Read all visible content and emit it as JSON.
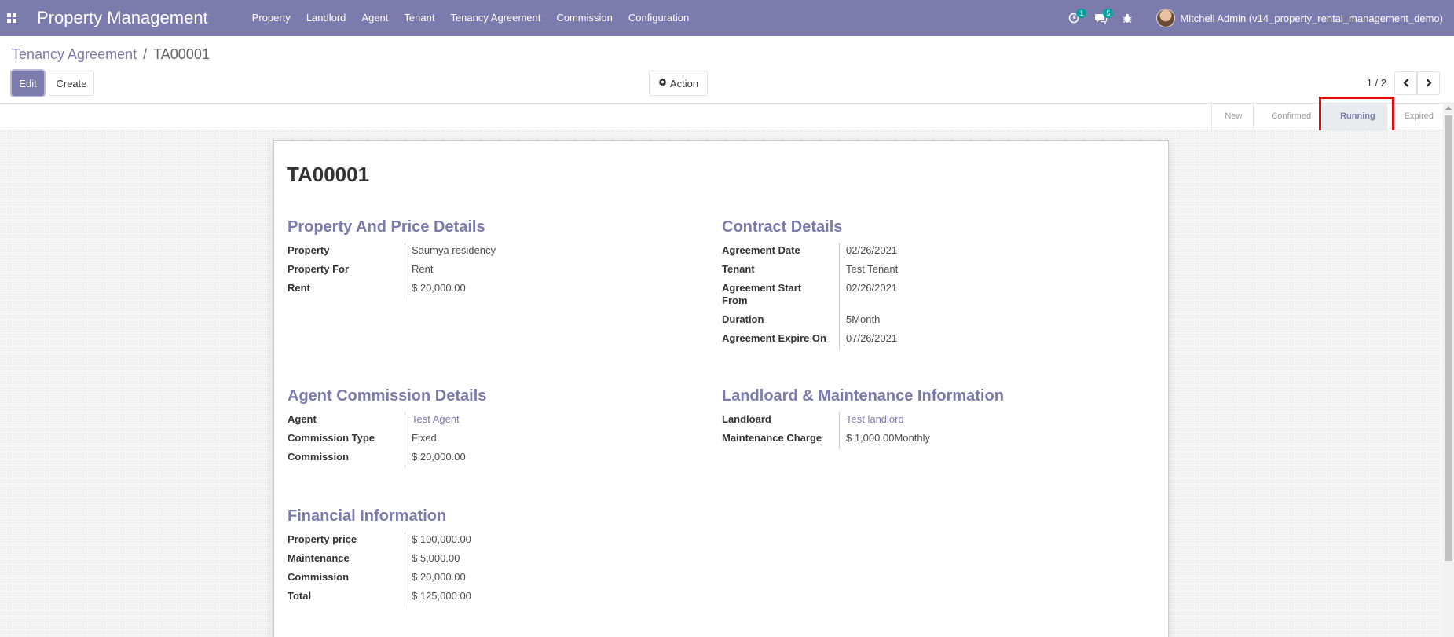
{
  "navbar": {
    "app_title": "Property Management",
    "menu": [
      "Property",
      "Landlord",
      "Agent",
      "Tenant",
      "Tenancy Agreement",
      "Commission",
      "Configuration"
    ],
    "activity_count": "1",
    "message_count": "5",
    "user_name": "Mitchell Admin (v14_property_rental_management_demo)"
  },
  "breadcrumb": {
    "parent": "Tenancy Agreement",
    "separator": "/",
    "current": "TA00001"
  },
  "buttons": {
    "edit": "Edit",
    "create": "Create",
    "action": "Action"
  },
  "pager": {
    "value": "1 / 2"
  },
  "statusbar": {
    "stages": [
      "New",
      "Confirmed",
      "Running",
      "Expired"
    ],
    "active": "Running"
  },
  "record": {
    "name": "TA00001",
    "property_section": {
      "title": "Property And Price Details",
      "fields": [
        {
          "label": "Property",
          "value": "Saumya residency"
        },
        {
          "label": "Property For",
          "value": "Rent"
        },
        {
          "label": "Rent",
          "value": "$ 20,000.00"
        }
      ]
    },
    "contract_section": {
      "title": "Contract Details",
      "fields": [
        {
          "label": "Agreement Date",
          "value": "02/26/2021"
        },
        {
          "label": "Tenant",
          "value": "Test Tenant"
        },
        {
          "label": "Agreement Start From",
          "value": "02/26/2021"
        },
        {
          "label": "Duration",
          "value": "5Month"
        },
        {
          "label": "Agreement Expire On",
          "value": "07/26/2021"
        }
      ]
    },
    "agent_section": {
      "title": "Agent Commission Details",
      "fields": [
        {
          "label": "Agent",
          "value": "Test Agent"
        },
        {
          "label": "Commission Type",
          "value": "Fixed"
        },
        {
          "label": "Commission",
          "value": "$ 20,000.00"
        }
      ]
    },
    "landlord_section": {
      "title": "Landloard & Maintenance Information",
      "fields": [
        {
          "label": "Landloard",
          "value": "Test landlord"
        },
        {
          "label": "Maintenance Charge",
          "value": "$ 1,000.00Monthly"
        }
      ]
    },
    "financial_section": {
      "title": "Financial Information",
      "fields": [
        {
          "label": "Property price",
          "value": "$ 100,000.00"
        },
        {
          "label": "Maintenance",
          "value": "$ 5,000.00"
        },
        {
          "label": "Commission",
          "value": "$ 20,000.00"
        },
        {
          "label": "Total",
          "value": "$ 125,000.00"
        }
      ]
    }
  },
  "colors": {
    "brand": "#7c7bad",
    "highlight": "#e8090c",
    "badge": "#00a09d"
  },
  "icons": [
    "apps-grid-icon",
    "activity-clock-icon",
    "chat-icon",
    "bug-icon",
    "gear-icon",
    "chevron-left-icon",
    "chevron-right-icon"
  ]
}
